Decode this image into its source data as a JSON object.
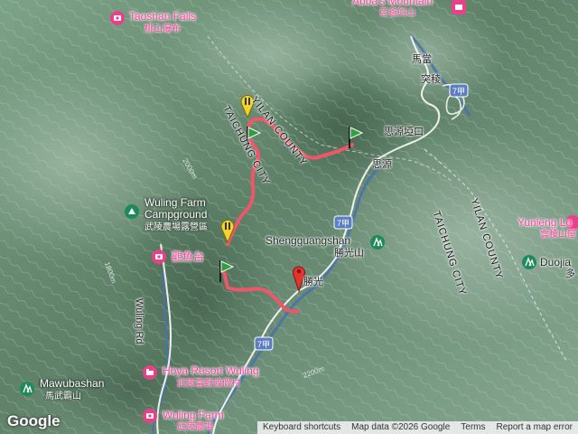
{
  "labels": {
    "taoshan_falls": "Taoshan Falls",
    "taoshan_falls_zh": "桃山瀑布",
    "abbas_mountain": "Abba's Mountain",
    "abbas_mountain_zh": "亞爸的山",
    "madang": "馬當",
    "tuleng": "突稜",
    "siyuan_pass": "思源埡口",
    "siyuan": "思源",
    "wuling_farm_campground_1": "Wuling Farm",
    "wuling_farm_campground_2": "Campground",
    "wuling_farm_campground_zh": "武陵農場露營區",
    "guanyutai": "觀魚台",
    "shengguangshan": "Shengguangshan",
    "shengguangshan_zh": "勝光山",
    "shengguang": "勝光",
    "yunleng": "Yunleng Lo",
    "yunleng_zh": "雲稜山屋",
    "duojia": "Duojia",
    "duojia_zh": "多",
    "mawubashan": "Mawubashan",
    "mawubashan_zh": "馬武霸山",
    "hoya_resort": "Hoya Resort Wuling",
    "hoya_resort_zh": "武陵富野渡假村",
    "wuling_farm": "Wuling Farm",
    "wuling_farm_zh": "武陵農場",
    "wuling_rd": "Wuling Rd",
    "route_7a_1": "7甲",
    "route_7a_2": "7甲",
    "route_7a_3": "7甲",
    "yilan_county_1": "YILAN COUNTY",
    "taichung_city_1": "TAICHUNG CITY",
    "taichung_city_2": "TAICHUNG CITY",
    "yilan_county_2": "YILAN COUNTY",
    "contour_2200": "2200m",
    "contour_2000": "2000m",
    "contour_1800": "1800m"
  },
  "footer": {
    "logo": "Google",
    "shortcuts": "Keyboard shortcuts",
    "map_data": "Map data ©2026 Google",
    "terms": "Terms",
    "report": "Report a map error"
  },
  "colors": {
    "track": "#f0566a",
    "river": "#4a72a8",
    "poi_green": "#1e8a5c",
    "poi_pink": "#e8418a",
    "start_flag": "#2e9e3e",
    "waypoint": "#f2d42a",
    "end_pin": "#e5332d"
  },
  "markers": [
    {
      "type": "start-flag"
    },
    {
      "type": "start-flag"
    },
    {
      "type": "start-flag"
    },
    {
      "type": "waypoint-pin"
    },
    {
      "type": "waypoint-pin"
    },
    {
      "type": "end-pin"
    }
  ]
}
